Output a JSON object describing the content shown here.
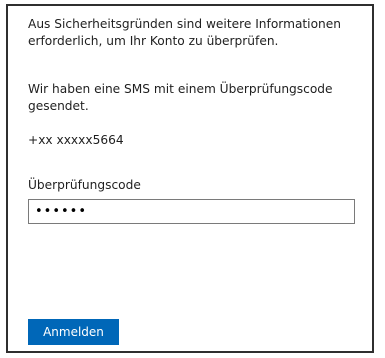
{
  "messages": {
    "intro": "Aus Sicherheitsgründen sind weitere Informationen erforderlich, um Ihr Konto zu überprüfen.",
    "sms_sent": "Wir haben eine SMS mit einem Überprüfungscode gesendet.",
    "phone_number": "+xx xxxxx5664"
  },
  "verification": {
    "label": "Überprüfungscode",
    "value": "••••••"
  },
  "actions": {
    "signin_label": "Anmelden"
  },
  "colors": {
    "primary_button": "#0067b8",
    "panel_border": "#2f2f2f"
  }
}
